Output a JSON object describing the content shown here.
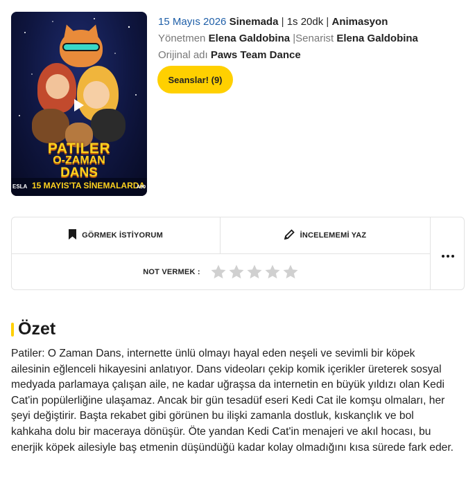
{
  "poster": {
    "title_line1": "PATILER",
    "title_line2": "O-ZAMAN",
    "title_line3": "DANS",
    "band_left": "ESLA",
    "band_date": "15 MAYIS'TA SİNEMALARDA",
    "band_right": "A90"
  },
  "info": {
    "release_date": "15 Mayıs 2026",
    "status": "Sinemada",
    "duration": "1s 20dk",
    "genre": "Animasyon",
    "director_label": "Yönetmen",
    "director": "Elena Galdobina",
    "writer_label": "Senarist",
    "writer": "Elena Galdobina",
    "original_title_label": "Orijinal adı",
    "original_title": "Paws Team Dance",
    "separator": "|"
  },
  "seanslar_button": "Seanslar! (9)",
  "actions": {
    "want_label": "GÖRMEK İSTİYORUM",
    "review_label": "İNCELEMEMİ YAZ",
    "rate_label": "NOT VERMEK :",
    "rating": 0,
    "max_rating": 5
  },
  "summary": {
    "title": "Özet",
    "text": "Patiler: O Zaman Dans, internette ünlü olmayı hayal eden neşeli ve sevimli bir köpek ailesinin eğlenceli hikayesini anlatıyor. Dans videoları çekip komik içerikler üreterek sosyal medyada parlamaya çalışan aile, ne kadar uğraşsa da internetin en büyük yıldızı olan Kedi Cat'in popülerliğine ulaşamaz. Ancak bir gün tesadüf eseri Kedi Cat ile komşu olmaları, her şeyi değiştirir. Başta rekabet gibi görünen bu ilişki zamanla dostluk, kıskançlık ve bol kahkaha dolu bir maceraya dönüşür. Öte yandan Kedi Cat'in menajeri ve akıl hocası, bu enerjik köpek ailesiyle baş etmenin düşündüğü kadar kolay olmadığını kısa sürede fark eder."
  },
  "colors": {
    "accent_yellow": "#ffd000",
    "date_blue": "#1f5fa8",
    "star_gray": "#d0d0d0"
  }
}
